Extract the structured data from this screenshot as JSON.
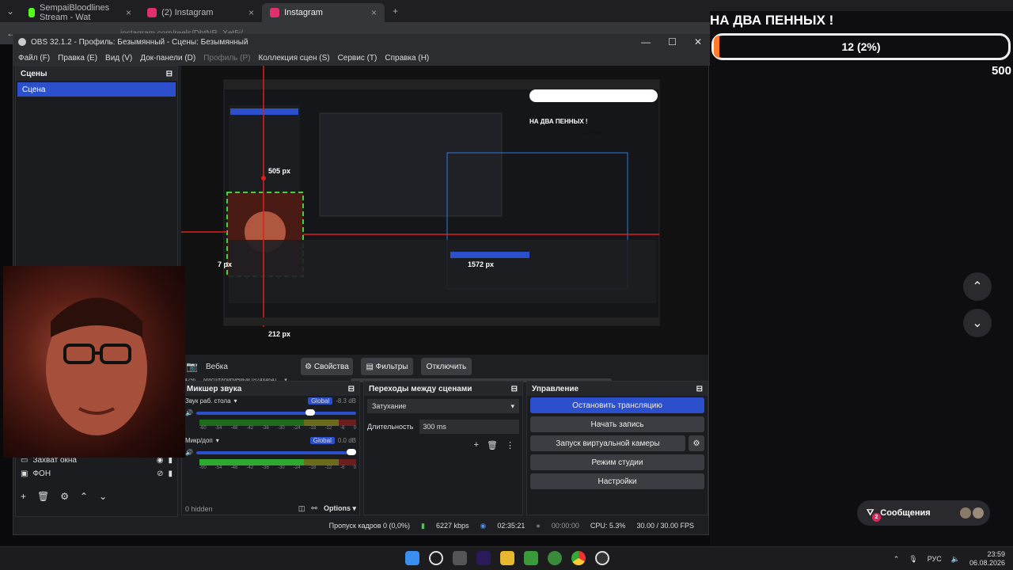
{
  "browser": {
    "tabs": [
      {
        "label": "SempaiBloodlines Stream - Wat",
        "color": "#53fc18"
      },
      {
        "label": "(2) Instagram",
        "color": "#e1306c"
      },
      {
        "label": "Instagram",
        "color": "#e1306c"
      }
    ],
    "url": "instagram.com/reels/DhtNP...Xet5j/"
  },
  "obs": {
    "title": "OBS 32.1.2 - Профиль: Безымянный - Сцены: Безымянный",
    "menu": [
      "Файл (F)",
      "Правка (E)",
      "Вид (V)",
      "Док-панели (D)",
      "Профиль (P)",
      "Коллекция сцен (S)",
      "Сервис (T)",
      "Справка (H)"
    ],
    "scenes_header": "Сцены",
    "scene_item": "Сцена",
    "sources": [
      "Захват окна",
      "ФОН"
    ],
    "preview": {
      "measure_top": "505 px",
      "measure_left": "7 px",
      "measure_bottom": "212 px",
      "measure_right": "1572 px",
      "zoom": "42%",
      "scale_label": "Масштабируемый (824x464)"
    },
    "source_bar": {
      "source": "Вебка",
      "properties": "Свойства",
      "filters": "Фильтры",
      "disable": "Отключить"
    },
    "mixer": {
      "header": "Микшер звука",
      "channels": [
        {
          "name": "Звук раб. стола",
          "badge": "Global",
          "db": "-8.3 dB"
        },
        {
          "name": "Микр/доп",
          "badge": "Global",
          "db": "0.0 dB"
        }
      ],
      "scale": [
        "-60",
        "-54",
        "-48",
        "-42",
        "-36",
        "-30",
        "-24",
        "-18",
        "-12",
        "-6",
        "0"
      ],
      "hidden": "0 hidden",
      "options": "Options"
    },
    "transitions": {
      "header": "Переходы между сценами",
      "type": "Затухание",
      "duration_label": "Длительность",
      "duration": "300 ms"
    },
    "controls": {
      "header": "Управление",
      "buttons": [
        "Остановить трансляцию",
        "Начать запись",
        "Запуск виртуальной камеры",
        "Режим студии",
        "Настройки"
      ]
    },
    "status": {
      "dropped": "Пропуск кадров 0 (0,0%)",
      "bitrate": "6227 kbps",
      "stream_time": "02:35:21",
      "rec_time": "00:00:00",
      "cpu": "CPU: 5.3%",
      "fps": "30.00 / 30.00 FPS"
    }
  },
  "overlay": {
    "goal_title": "НА ДВА ПЕННЫХ !",
    "goal_value": "12 (2%)",
    "goal_progress": 0.02,
    "goal_target": "500"
  },
  "chat": {
    "messages_label": "Сообщения",
    "badge": "2"
  },
  "taskbar": {
    "lang": "РУС",
    "time": "23:59",
    "date": "06.08.2026"
  }
}
